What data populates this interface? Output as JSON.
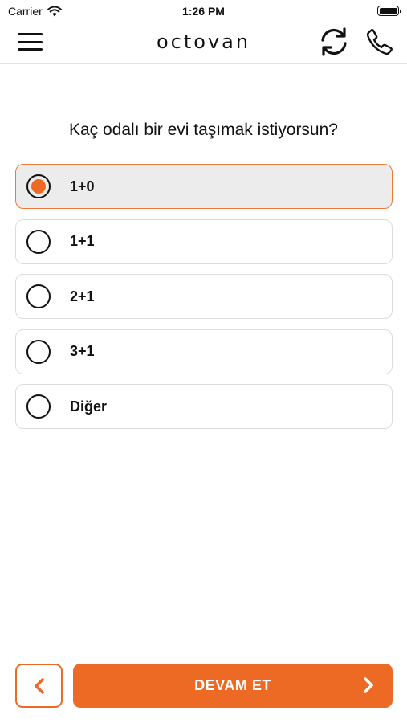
{
  "status_bar": {
    "carrier": "Carrier",
    "time": "1:26 PM",
    "wifi_icon": "wifi-icon",
    "battery_icon": "battery-icon"
  },
  "nav": {
    "menu_icon": "hamburger-menu-icon",
    "logo": "octovan",
    "refresh_icon": "refresh-icon",
    "phone_icon": "phone-icon"
  },
  "question": "Kaç odalı bir evi taşımak istiyorsun?",
  "options": [
    {
      "label": "1+0",
      "selected": true
    },
    {
      "label": "1+1",
      "selected": false
    },
    {
      "label": "2+1",
      "selected": false
    },
    {
      "label": "3+1",
      "selected": false
    },
    {
      "label": "Diğer",
      "selected": false
    }
  ],
  "footer": {
    "back_icon": "chevron-left-icon",
    "continue_label": "DEVAM ET",
    "continue_icon": "chevron-right-icon"
  },
  "colors": {
    "accent": "#ed6a24",
    "selected_bg": "#ececec",
    "border": "#dcdcdc"
  }
}
